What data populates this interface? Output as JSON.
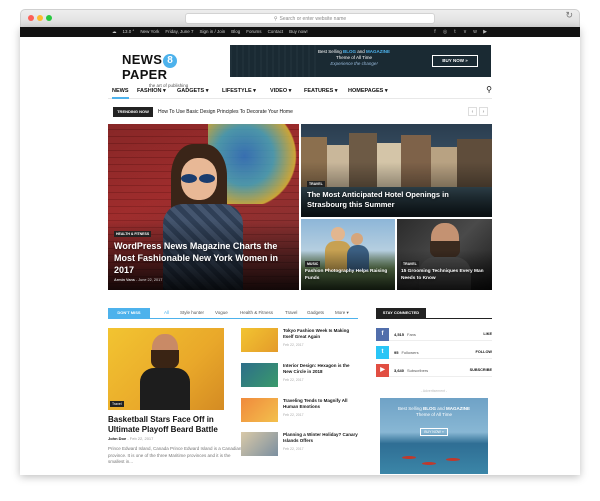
{
  "browser": {
    "url_placeholder": "Search or enter website name"
  },
  "topbar": {
    "weather": "13.0 °",
    "city": "New York",
    "date": "Friday, June 7",
    "links": [
      "Sign in / Join",
      "Blog",
      "Forums",
      "Contact",
      "Buy now!"
    ],
    "social_icons": [
      "facebook-icon",
      "instagram-icon",
      "twitter-icon",
      "vimeo-icon",
      "vk-icon",
      "youtube-icon"
    ]
  },
  "logo": {
    "part1": "NEWS",
    "digit": "8",
    "part2": "PAPER",
    "tagline": "the art of publishing"
  },
  "banner": {
    "line1_a": "Best Selling ",
    "line1_b": "BLOG",
    "line1_c": " and ",
    "line1_d": "MAGAZINE",
    "line2": "Theme of All Time",
    "line3": "Experience the change!",
    "button": "BUY NOW »"
  },
  "nav": {
    "items": [
      "NEWS",
      "FASHION ▾",
      "GADGETS ▾",
      "LIFESTYLE ▾",
      "VIDEO ▾",
      "FEATURES ▾",
      "HOMEPAGES ▾"
    ],
    "search_icon": "search-icon"
  },
  "trending": {
    "label": "TRENDING NOW",
    "headline": "How To Use Basic Design Principles To Decorate Your Home",
    "prev": "‹",
    "next": "›"
  },
  "featured": [
    {
      "category": "HEALTH & FITNESS",
      "title": "WordPress News Magazine Charts the Most Fashionable New York Women in 2017",
      "author": "Armin Vans",
      "date": "June 22, 2017"
    },
    {
      "category": "TRAVEL",
      "title": "The Most Anticipated Hotel Openings in Strasbourg this Summer"
    },
    {
      "category": "MUSIC",
      "title": "Fashion Photography Helps Raising Funds"
    },
    {
      "category": "TRAVEL",
      "title": "15 Grooming Techniques Every Man Needs to Know"
    }
  ],
  "section": {
    "label": "DON'T MISS",
    "tabs": [
      "All",
      "Style hunter",
      "Vogue",
      "Health & Fitness",
      "Travel",
      "Gadgets",
      "More ▾"
    ]
  },
  "main_post": {
    "category": "Travel",
    "title": "Basketball Stars Face Off in Ultimate Playoff Beard Battle",
    "author": "John Doe",
    "date": "Feb 22, 2017",
    "comments": "0",
    "excerpt": "Prince Edward Island, Canada Prince Edward Island is a Canadian province. It is one of the three Maritime provinces and it is the smallest in..."
  },
  "side_posts": [
    {
      "title": "Tokyo Fashion Week Is Making Itself Great Again",
      "date": "Feb 22, 2017"
    },
    {
      "title": "Interior Design: Hexagon is the New Circle in 2018",
      "date": "Feb 22, 2017"
    },
    {
      "title": "Traveling Tends to Magnify All Human Emotions",
      "date": "Feb 22, 2017"
    },
    {
      "title": "Planning a Winter Holiday? Canary Islands Offers",
      "date": "Feb 22, 2017"
    }
  ],
  "stay_connected": {
    "label": "STAY CONNECTED",
    "rows": [
      {
        "icon": "facebook-icon",
        "glyph": "f",
        "count": "4,515",
        "unit": "Fans",
        "action": "LIKE",
        "color": "#516eab"
      },
      {
        "icon": "twitter-icon",
        "glyph": "t",
        "count": "95",
        "unit": "Followers",
        "action": "FOLLOW",
        "color": "#29c5f6"
      },
      {
        "icon": "youtube-icon",
        "glyph": "▶",
        "count": "3,640",
        "unit": "Subscribers",
        "action": "SUBSCRIBE",
        "color": "#e14e42"
      }
    ]
  },
  "ad2": {
    "label": "- Advertisement -",
    "line1_a": "Best Selling ",
    "line1_b": "BLOG",
    "line1_c": " and ",
    "line1_d": "MAGAZINE",
    "line2": "Theme of All Time",
    "button": "BUY NOW »"
  },
  "colors": {
    "accent": "#4db2ec",
    "dark": "#222222"
  }
}
